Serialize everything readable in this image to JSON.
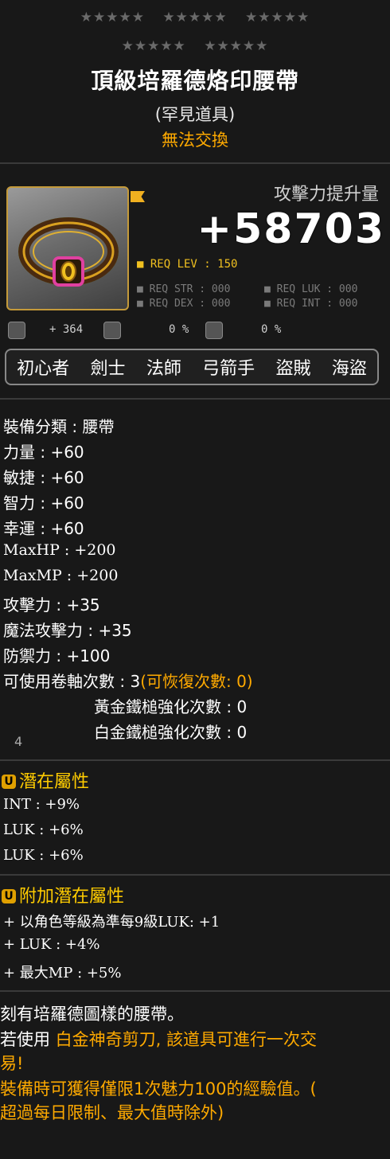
{
  "item": {
    "stars_row1": [
      "★★★★★",
      "★★★★★",
      "★★★★★"
    ],
    "stars_row2": [
      "★★★★★",
      "★★★★★"
    ],
    "name": "頂級培羅德烙印腰帶",
    "rarity": "(罕見道具)",
    "tradeability": "無法交換",
    "icon": "belt-icon"
  },
  "attack_gain": {
    "label": "攻擊力提升量",
    "value": "+58703"
  },
  "requirements": {
    "level": "■ REQ LEV : 150",
    "str": "■ REQ STR : 000",
    "dex": "■ REQ DEX : 000",
    "luk": "■ REQ LUK : 000",
    "int": "■ REQ INT : 000"
  },
  "mini_stats": [
    {
      "icon": "growth-icon",
      "value": "+ 364"
    },
    {
      "icon": "upgrade-icon",
      "value": "0 %"
    },
    {
      "icon": "shield-icon",
      "value": "0 %"
    }
  ],
  "jobs": [
    "初心者",
    "劍士",
    "法師",
    "弓箭手",
    "盜賊",
    "海盜"
  ],
  "stats": {
    "category": "裝備分類 : 腰帶",
    "str": "力量 : +60",
    "dex": "敏捷 : +60",
    "int": "智力 : +60",
    "luk": "幸運 : +60",
    "maxhp": "MaxHP : +200",
    "maxmp": "MaxMP : +200",
    "atk": "攻擊力 : +35",
    "matk": "魔法攻擊力 : +35",
    "def": "防禦力 : +100",
    "scrolls": "可使用卷軸次數 : 3",
    "scrolls_recover": "(可恢復次數: 0)",
    "golden_hammer": "黃金鐵槌強化次數 : 0",
    "platinum_hammer": "白金鐵槌強化次數 : 0"
  },
  "slot_number": "4",
  "potential": {
    "badge": "U",
    "title": "潛在屬性",
    "lines": [
      "INT : +9%",
      "LUK : +6%",
      "LUK : +6%"
    ]
  },
  "bonus_potential": {
    "badge": "U",
    "title": "附加潛在屬性",
    "lines": [
      "+ 以角色等級為準每9級LUK: +1",
      "+ LUK : +4%",
      "+ 最大MP : +5%"
    ]
  },
  "description": {
    "line1": "刻有培羅德圖樣的腰帶。",
    "line2_prefix": "若使用",
    "line2_orange": " 白金神奇剪刀, 該道具可進行一次交",
    "line3": "易!",
    "line4": " 裝備時可獲得僅限1次魅力100的經驗值。(",
    "line5": "超過每日限制、最大值時除外)"
  },
  "colors": {
    "gold": "#ffaa00",
    "potential_yellow": "#ffcc00",
    "icon_border": "#c49a3a",
    "req_level": "#f0c020"
  }
}
